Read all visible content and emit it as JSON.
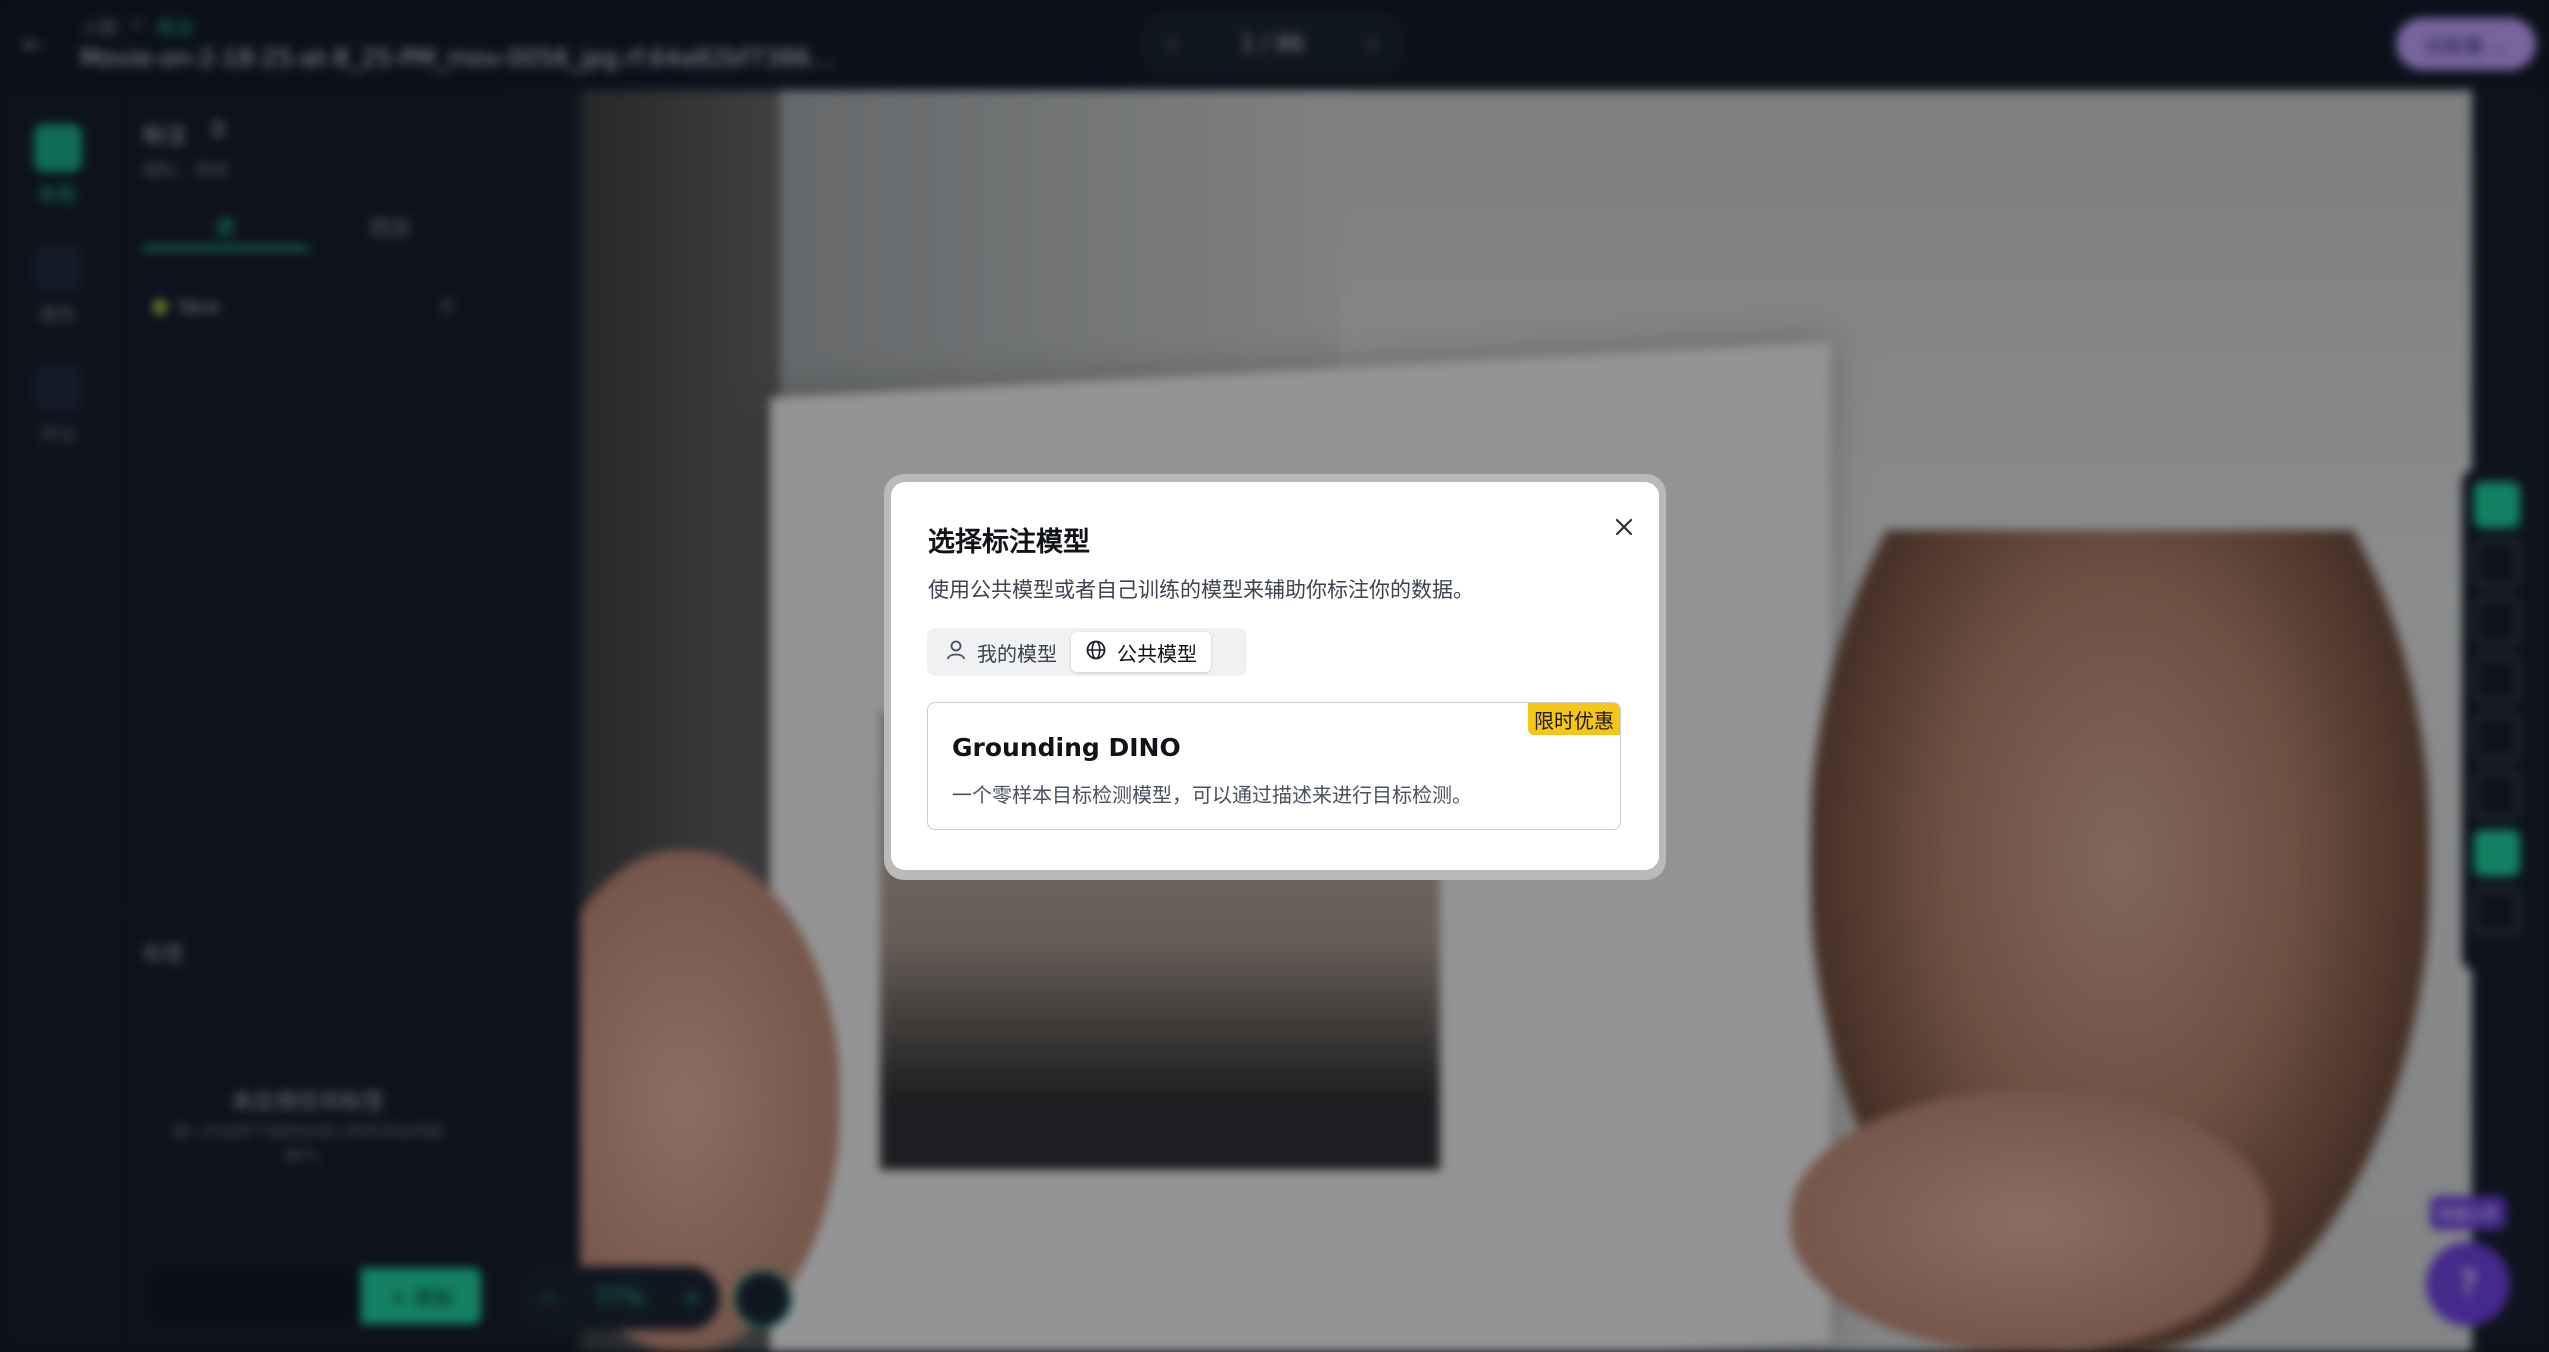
{
  "header": {
    "breadcrumb": [
      "人脸",
      "标注"
    ],
    "file_title": "Movie-on-2-18-25-at-8_25-PM_mov-0056_jpg.rf.64a82bf7386…",
    "pager": {
      "prev": "‹",
      "text": "1 / 86",
      "next": "›"
    },
    "train_button": "训练集 ⌄"
  },
  "rail": {
    "items": [
      {
        "label": "标签",
        "icon": "annotate-icon",
        "active": true
      },
      {
        "label": "属性",
        "icon": "attributes-icon",
        "active": false
      },
      {
        "label": "评论",
        "icon": "comment-icon",
        "active": false
      }
    ]
  },
  "panel": {
    "annotations_label": "标注",
    "annotations_count": "0",
    "team_label": "团队：测试",
    "tabs": [
      "类",
      "图层"
    ],
    "classes": [
      {
        "name": "face",
        "count": "0",
        "color": "#b7d64a"
      }
    ],
    "tags_title": "标签",
    "empty_title": "未应用任何标签",
    "empty_sub": "键入并选择下面的标签以将其添加到图像中。",
    "add_button": "+ 添加"
  },
  "canvas": {
    "zoom": {
      "minus": "−",
      "value": "77%",
      "plus": "+"
    },
    "help_badge": "快速上手",
    "help_fab": "?"
  },
  "modal": {
    "title": "选择标注模型",
    "description": "使用公共模型或者自己训练的模型来辅助你标注你的数据。",
    "tabs": [
      {
        "label": "我的模型",
        "icon": "user-icon",
        "active": false
      },
      {
        "label": "公共模型",
        "icon": "globe-icon",
        "active": true
      }
    ],
    "models": [
      {
        "name": "Grounding DINO",
        "description": "一个零样本目标检测模型，可以通过描述来进行目标检测。",
        "badge": "限时优惠"
      }
    ]
  },
  "colors": {
    "accent": "#1fc79a",
    "promo": "#f5c518",
    "fab": "#6a3fd6"
  }
}
